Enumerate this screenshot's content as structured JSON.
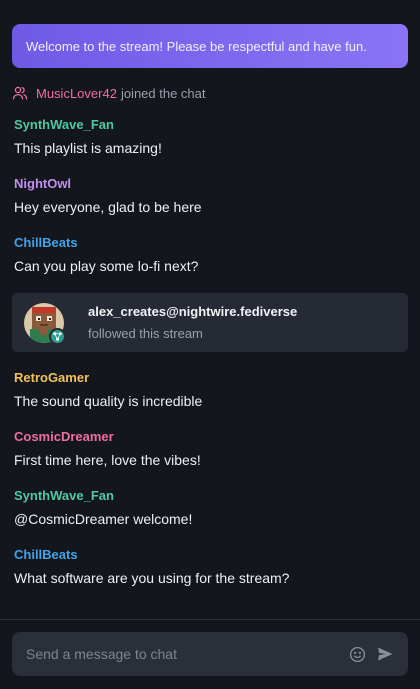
{
  "banner": {
    "text": "Welcome to the stream! Please be respectful and have fun."
  },
  "join_event": {
    "user": "MusicLover42",
    "action": "joined the chat",
    "icon": "users-icon"
  },
  "messages_top": [
    {
      "user": "SynthWave_Fan",
      "color": "#4ec9a0",
      "text": "This playlist is amazing!"
    },
    {
      "user": "NightOwl",
      "color": "#c48ef2",
      "text": "Hey everyone, glad to be here"
    },
    {
      "user": "ChillBeats",
      "color": "#3ea3e8",
      "text": "Can you play some lo-fi next?"
    }
  ],
  "follow_event": {
    "user": "alex_creates@nightwire.fediverse",
    "action": "followed this stream",
    "badge_icon": "fediverse-icon"
  },
  "messages_bottom": [
    {
      "user": "RetroGamer",
      "color": "#f2c25a",
      "text": "The sound quality is incredible"
    },
    {
      "user": "CosmicDreamer",
      "color": "#ee6ea0",
      "text": "First time here, love the vibes!"
    },
    {
      "user": "SynthWave_Fan",
      "color": "#4ec9a0",
      "text": "@CosmicDreamer welcome!"
    },
    {
      "user": "ChillBeats",
      "color": "#3ea3e8",
      "text": "What software are you using for the stream?"
    }
  ],
  "composer": {
    "placeholder": "Send a message to chat",
    "emoji_icon": "smile-icon",
    "send_icon": "send-icon"
  },
  "colors": {
    "background": "#13161c",
    "banner": "#7b66ee",
    "card": "#252a34",
    "input": "#2a2f3a"
  }
}
